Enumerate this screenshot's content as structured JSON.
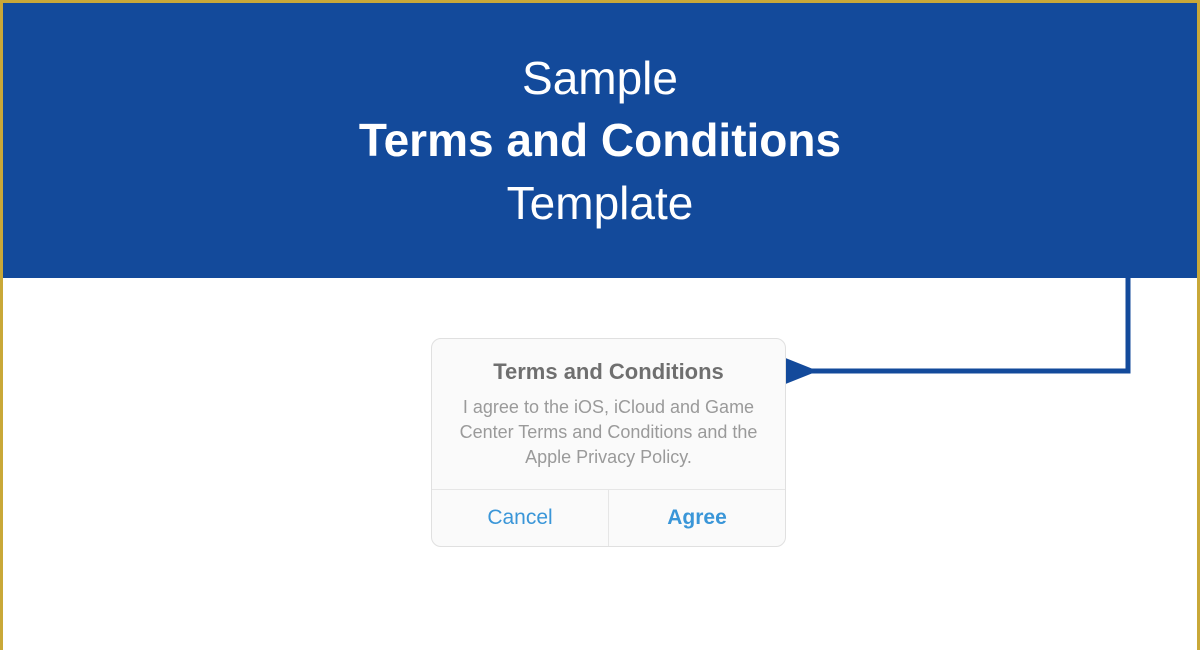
{
  "header": {
    "line1": "Sample",
    "line2": "Terms and Conditions",
    "line3": "Template"
  },
  "dialog": {
    "title": "Terms and Conditions",
    "body": "I agree to the iOS, iCloud and Game Center Terms and Conditions and the Apple Privacy Policy.",
    "cancel": "Cancel",
    "agree": "Agree"
  },
  "colors": {
    "banner": "#134a9b",
    "frame": "#c9a838",
    "button": "#3a96d8"
  }
}
